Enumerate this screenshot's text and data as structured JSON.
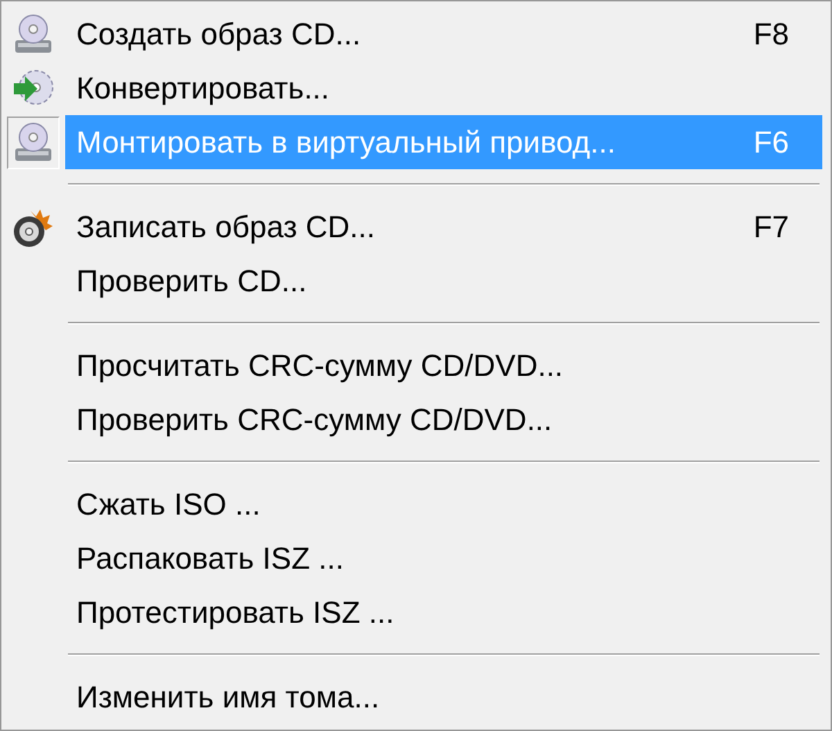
{
  "menu": {
    "items": [
      {
        "kind": "drive",
        "label": "Создать образ CD...",
        "shortcut": "F8",
        "selected": false
      },
      {
        "kind": "convert",
        "label": "Конвертировать...",
        "selected": false
      },
      {
        "kind": "drive",
        "label": "Монтировать в виртуальный привод...",
        "shortcut": "F6",
        "selected": true
      },
      {
        "kind": "separator"
      },
      {
        "kind": "burn",
        "label": "Записать образ CD...",
        "shortcut": "F7",
        "selected": false
      },
      {
        "kind": "plain",
        "label": "Проверить CD...",
        "selected": false
      },
      {
        "kind": "separator"
      },
      {
        "kind": "plain",
        "label": "Просчитать CRC-сумму CD/DVD...",
        "selected": false
      },
      {
        "kind": "plain",
        "label": "Проверить CRC-сумму CD/DVD...",
        "selected": false
      },
      {
        "kind": "separator"
      },
      {
        "kind": "plain",
        "label": "Сжать ISO ...",
        "selected": false
      },
      {
        "kind": "plain",
        "label": "Распаковать ISZ ...",
        "selected": false
      },
      {
        "kind": "plain",
        "label": "Протестировать ISZ ...",
        "selected": false
      },
      {
        "kind": "separator"
      },
      {
        "kind": "plain",
        "label": "Изменить имя тома...",
        "selected": false
      }
    ]
  }
}
